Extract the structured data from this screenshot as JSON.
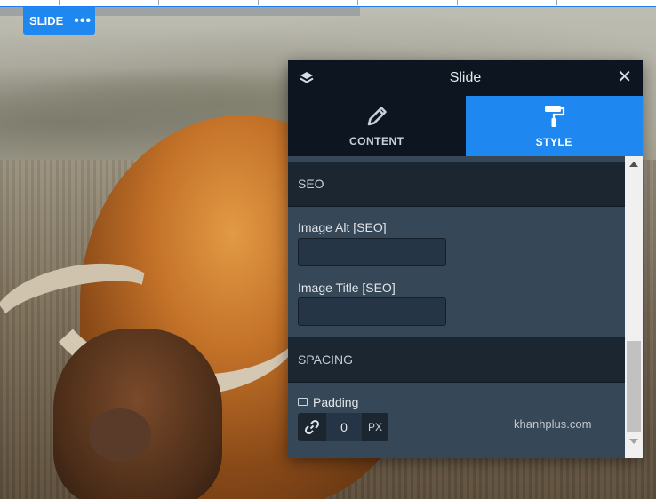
{
  "element_tag": {
    "label": "SLIDE",
    "more_icon": "ellipsis-icon"
  },
  "panel": {
    "title": "Slide",
    "layers_icon": "layers-icon",
    "close_icon": "close-icon",
    "tabs": [
      {
        "label": "CONTENT",
        "icon": "pencil-icon",
        "active": false
      },
      {
        "label": "STYLE",
        "icon": "paint-roller-icon",
        "active": true
      }
    ],
    "sections": {
      "seo": {
        "title": "SEO",
        "image_alt_label": "Image Alt [SEO]",
        "image_alt_value": "",
        "image_title_label": "Image Title [SEO]",
        "image_title_value": ""
      },
      "spacing": {
        "title": "SPACING",
        "padding_label": "Padding",
        "padding_value": "0",
        "padding_unit": "PX"
      }
    }
  },
  "watermark": "khanhplus.com",
  "colors": {
    "accent": "#1e87f0",
    "panel_header": "#0d1620",
    "panel_body": "#364758",
    "section": "#1c2631"
  }
}
